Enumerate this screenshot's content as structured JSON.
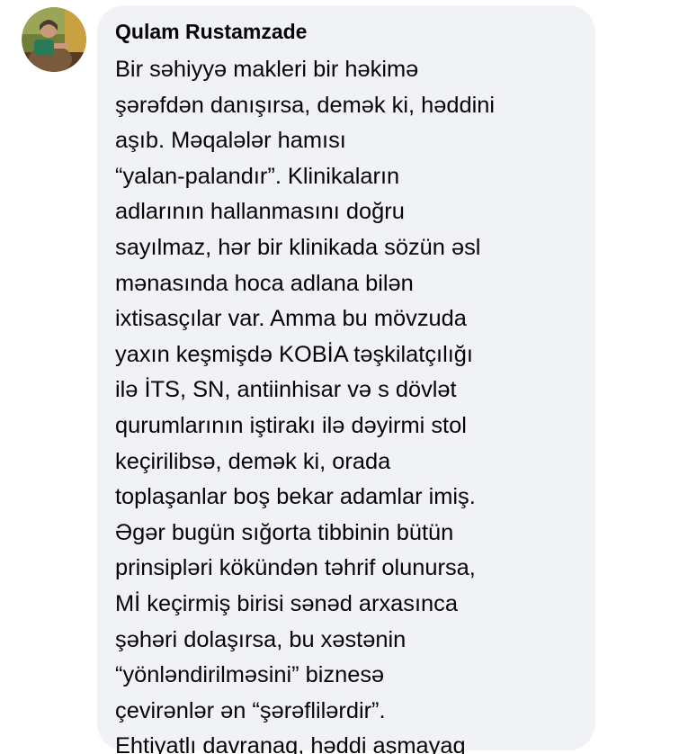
{
  "comment": {
    "author": "Qulam Rustamzade",
    "avatar_icon": "user-photo-avatar",
    "lines": [
      "Bir səhiyyə makleri bir həkimə",
      "şərəfdən danışırsa, demək ki, həddini",
      "aşıb. Məqalələr hamısı",
      "“yalan-palandır”. Klinikaların",
      "adlarının hallanmasını doğru",
      "sayılmaz, hər bir klinikada sözün əsl",
      "mənasında hoca adlana bilən",
      "ixtisasçılar var. Amma bu mövzuda",
      "yaxın keşmişdə KOBİA təşkilatçılığı",
      "ilə İTS, SN, antiinhisar və s dövlət",
      "qurumlarının iştirakı ilə dəyirmi stol",
      "keçirilibsə, demək ki, orada",
      "toplaşanlar boş bekar adamlar imiş.",
      "Əgər bugün sığorta tibbinin bütün",
      "prinsipləri kökündən təhrif olunursa,",
      "Mİ keçirmiş birisi sənəd arxasınca",
      "şəhəri dolaşırsa, bu xəstənin",
      "“yönləndirilməsini” biznesə",
      "çevirənlər ən “şərəflilərdir”.",
      "Ehtiyatlı davranaq, həddi aşmayaq"
    ]
  },
  "colors": {
    "bubble_background": "#f0f2f5",
    "text": "#050505",
    "page_background": "#ffffff"
  }
}
